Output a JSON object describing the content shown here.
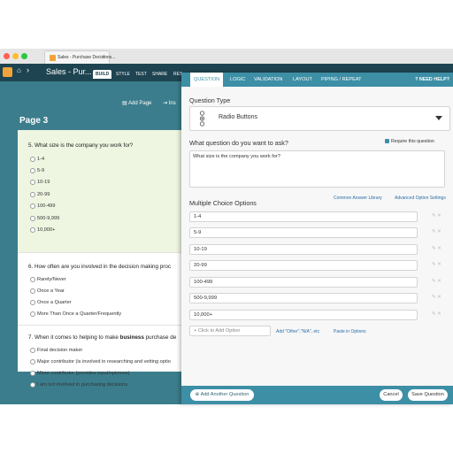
{
  "browser": {
    "tab_title": "Sales - Purchase Decisions...",
    "tab_close": "×"
  },
  "app": {
    "home_glyph": "⌂",
    "caret_glyph": "›",
    "survey_title": "Sales - Pur...",
    "nav": [
      "BUILD",
      "STYLE",
      "TEST",
      "SHARE",
      "RES"
    ]
  },
  "toolbar": {
    "add_page": "Add Page",
    "insert": "Ins"
  },
  "page": {
    "heading": "Page 3",
    "questions": [
      {
        "title": "5. What size is the company you work for?",
        "options": [
          "1-4",
          "5-9",
          "10-19",
          "20-99",
          "100-499",
          "500-9,999",
          "10,000+"
        ]
      },
      {
        "title": "6. How often are you involved in the decision making proc",
        "options": [
          "Rarely/Never",
          "Once a Year",
          "Once a Quarter",
          "More Than Once a Quarter/Frequently"
        ]
      },
      {
        "title_prefix": "7. When it comes to helping to make ",
        "title_bold": "business",
        "title_suffix": " purchase de",
        "options": [
          "Final decision maker",
          "Major contributor (is involved in researching and vetting optio",
          "Minor contributor (provides input/opinions)",
          "I am not involved in purchasing decisions"
        ]
      }
    ]
  },
  "editor": {
    "tabs": [
      "QUESTION",
      "LOGIC",
      "VALIDATION",
      "LAYOUT",
      "PIPING / REPEAT"
    ],
    "help": "? NEED HELP?",
    "question_type_label": "Question Type",
    "question_type_value": "Radio Buttons",
    "ask_label": "What question do you want to ask?",
    "require_label": "Require this question",
    "question_text": "What size is the company you work for?",
    "common_library": "Common Answer Library",
    "advanced_settings": "Advanced Option Settings",
    "mc_label": "Multiple Choice Options",
    "choices": [
      "1-4",
      "5-9",
      "10-19",
      "20-99",
      "100-499",
      "500-9,999",
      "10,000+"
    ],
    "choice_tools": "✎ ✕",
    "add_option_placeholder": "+ Click to Add Option",
    "add_other": "Add \"Other\",\"N/A\", etc",
    "paste_options": "Paste in Options",
    "add_another": "⊕ Add Another Question",
    "cancel": "Cancel",
    "save": "Save Question"
  },
  "colors": {
    "app_bar": "#1f4451",
    "page_bg": "#3b7d8c",
    "panel_accent": "#3d8fa6",
    "logo": "#f2a33a"
  }
}
